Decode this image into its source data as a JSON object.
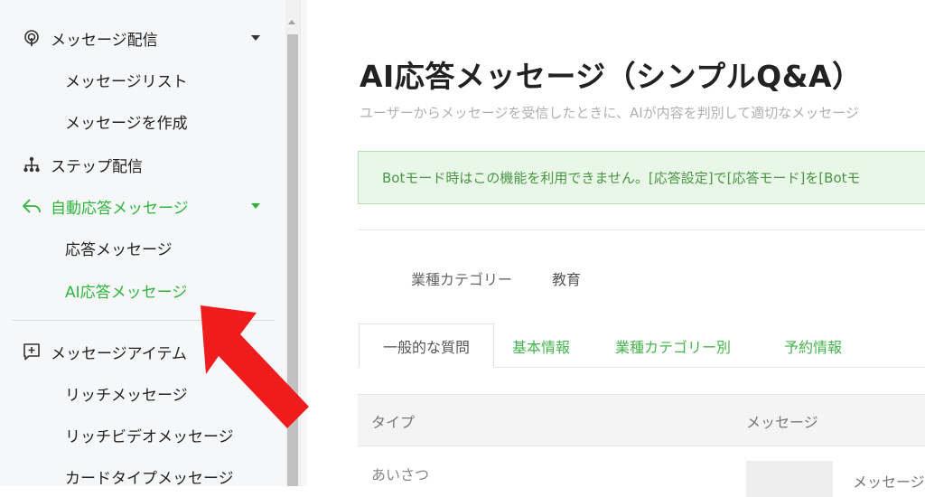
{
  "sidebar": {
    "items": [
      {
        "label": "メッセージ配信",
        "icon": "broadcast-icon"
      },
      {
        "label": "メッセージリスト"
      },
      {
        "label": "メッセージを作成"
      },
      {
        "label": "ステップ配信",
        "icon": "step-hierarchy-icon"
      },
      {
        "label": "自動応答メッセージ",
        "icon": "reply-arrow-icon"
      },
      {
        "label": "応答メッセージ"
      },
      {
        "label": "AI応答メッセージ"
      },
      {
        "label": "メッセージアイテム",
        "icon": "plus-message-icon"
      },
      {
        "label": "リッチメッセージ"
      },
      {
        "label": "リッチビデオメッセージ"
      },
      {
        "label": "カードタイプメッセージ"
      }
    ]
  },
  "main": {
    "title": "AI応答メッセージ（シンプルQ&A）",
    "description": "ユーザーからメッセージを受信したときに、AIが内容を判別して適切なメッセージ",
    "alert": "Botモード時はこの機能を利用できません。[応答設定]で[応答モード]を[Botモ",
    "industry_label": "業種カテゴリー",
    "industry_value": "教育",
    "tabs": [
      {
        "label": "一般的な質問"
      },
      {
        "label": "基本情報"
      },
      {
        "label": "業種カテゴリー別"
      },
      {
        "label": "予約情報"
      }
    ],
    "table": {
      "headers": [
        "タイプ",
        "メッセージ"
      ],
      "rows": [
        {
          "type": "あいさつ",
          "message": "メッセージ"
        }
      ]
    }
  },
  "colors": {
    "accent": "#2fb53d",
    "alert_bg": "#e8f7e7",
    "alert_text": "#4c9446",
    "arrow": "#ee1c1c"
  }
}
